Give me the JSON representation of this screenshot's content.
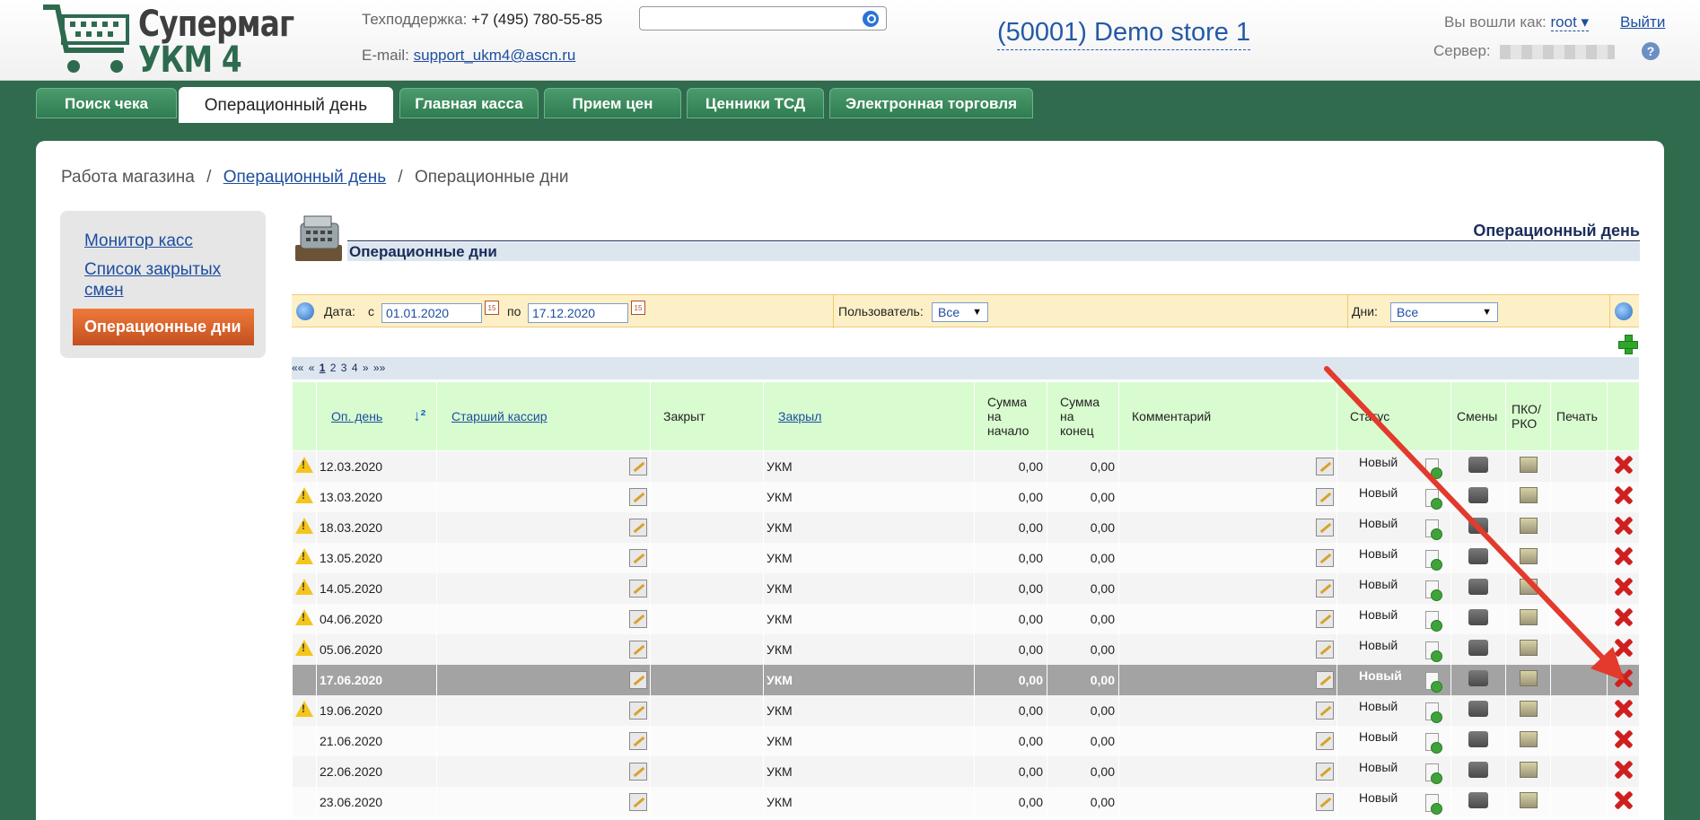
{
  "logo": {
    "line1": "Супермаг",
    "line2": "УКМ 4"
  },
  "support": {
    "label": "Техподдержка:",
    "phone": "+7 (495) 780-55-85",
    "email_label": "E-mail:",
    "email": "support_ukm4@ascn.ru"
  },
  "search": {
    "placeholder": ""
  },
  "store": "(50001) Demo store 1",
  "user": {
    "label": "Вы вошли как:",
    "name": "root ▾",
    "exit": "Выйти",
    "server_label": "Сервер:"
  },
  "tabs": [
    {
      "label": "Поиск чека"
    },
    {
      "label": "Операционный день"
    },
    {
      "label": "Главная касса"
    },
    {
      "label": "Прием цен"
    },
    {
      "label": "Ценники ТСД"
    },
    {
      "label": "Электронная торговля"
    }
  ],
  "breadcrumb": {
    "root": "Работа магазина",
    "sep": "/",
    "middle": "Операционный день",
    "current": "Операционные дни"
  },
  "sidebar": {
    "items": [
      {
        "label": "Монитор касс"
      },
      {
        "label": "Список закрытых смен"
      },
      {
        "label": "Операционные дни"
      }
    ]
  },
  "page": {
    "section_title": "Операционный день",
    "subtitle": "Операционные дни"
  },
  "filter": {
    "date_label": "Дата:",
    "from_label": "с",
    "from": "01.01.2020",
    "to_label": "по",
    "to": "17.12.2020",
    "user_label": "Пользователь:",
    "user_value": "Все",
    "days_label": "Дни:",
    "days_value": "Все"
  },
  "pager": {
    "first": "««",
    "prev": "«",
    "pages": [
      "1",
      "2",
      "3",
      "4"
    ],
    "next": "»",
    "last": "»»"
  },
  "table": {
    "headers": {
      "op_day": "Оп. день",
      "senior": "Старший кассир",
      "closed": "Закрыт",
      "closed_by": "Закрыл",
      "sum_start": "Сумма на начало",
      "sum_end": "Сумма на конец",
      "comment": "Комментарий",
      "status": "Статус",
      "shifts": "Смены",
      "pko": "ПКО/ РКО",
      "print": "Печать"
    },
    "rows": [
      {
        "warn": true,
        "date": "12.03.2020",
        "closed_by": "УКМ",
        "start": "0,00",
        "end": "0,00",
        "status": "Новый"
      },
      {
        "warn": true,
        "date": "13.03.2020",
        "closed_by": "УКМ",
        "start": "0,00",
        "end": "0,00",
        "status": "Новый"
      },
      {
        "warn": true,
        "date": "18.03.2020",
        "closed_by": "УКМ",
        "start": "0,00",
        "end": "0,00",
        "status": "Новый"
      },
      {
        "warn": true,
        "date": "13.05.2020",
        "closed_by": "УКМ",
        "start": "0,00",
        "end": "0,00",
        "status": "Новый"
      },
      {
        "warn": true,
        "date": "14.05.2020",
        "closed_by": "УКМ",
        "start": "0,00",
        "end": "0,00",
        "status": "Новый"
      },
      {
        "warn": true,
        "date": "04.06.2020",
        "closed_by": "УКМ",
        "start": "0,00",
        "end": "0,00",
        "status": "Новый"
      },
      {
        "warn": true,
        "date": "05.06.2020",
        "closed_by": "УКМ",
        "start": "0,00",
        "end": "0,00",
        "status": "Новый"
      },
      {
        "warn": false,
        "date": "17.06.2020",
        "closed_by": "УКМ",
        "start": "0,00",
        "end": "0,00",
        "status": "Новый",
        "selected": true
      },
      {
        "warn": true,
        "date": "19.06.2020",
        "closed_by": "УКМ",
        "start": "0,00",
        "end": "0,00",
        "status": "Новый"
      },
      {
        "warn": false,
        "date": "21.06.2020",
        "closed_by": "УКМ",
        "start": "0,00",
        "end": "0,00",
        "status": "Новый"
      },
      {
        "warn": false,
        "date": "22.06.2020",
        "closed_by": "УКМ",
        "start": "0,00",
        "end": "0,00",
        "status": "Новый"
      },
      {
        "warn": false,
        "date": "23.06.2020",
        "closed_by": "УКМ",
        "start": "0,00",
        "end": "0,00",
        "status": "Новый"
      }
    ]
  },
  "colors": {
    "brand_green": "#2f6b4c",
    "tab_green": "#3d8c5f",
    "header_green": "#d8fccf",
    "accent_orange": "#e0662b",
    "arrow_red": "#e23a2c",
    "link_blue": "#1d4ea0"
  }
}
